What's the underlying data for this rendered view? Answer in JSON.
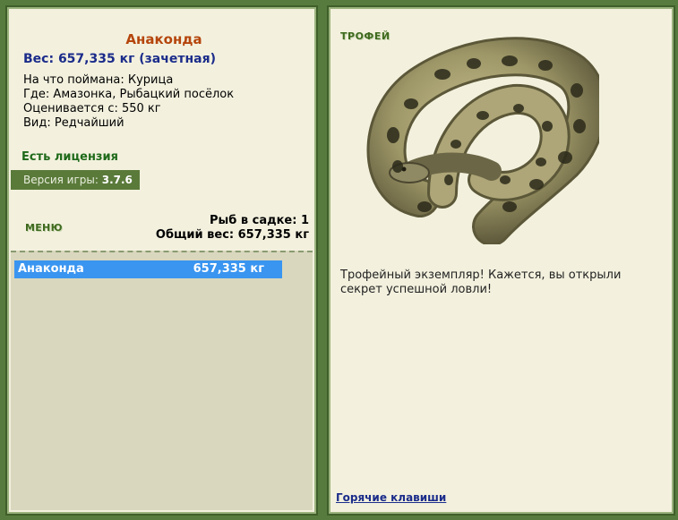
{
  "fish": {
    "name": "Анаконда",
    "weight_line": "Вес: 657,335 кг (зачетная)",
    "bait_line": "На что поймана: Курица",
    "location_line": "Где: Амазонка, Рыбацкий посёлок",
    "value_line": "Оценивается с: 550 кг",
    "kind_line": "Вид: Редчайший"
  },
  "license": "Есть лицензия",
  "version": {
    "label": "Версия игры:",
    "value": "3.7.6"
  },
  "menu_label": "МЕНЮ",
  "keepnet": {
    "count_line": "Рыб в садке: 1",
    "total_line": "Общий вес: 657,335 кг",
    "items": [
      {
        "name": "Анаконда",
        "weight": "657,335 кг",
        "selected": true
      }
    ]
  },
  "trophy": {
    "title": "ТРОФЕЙ",
    "image_icon": "anaconda-image",
    "text": "Трофейный экземпляр! Кажется, вы открыли секрет успешной ловли!"
  },
  "hotkeys_label": "Горячие клавиши",
  "colors": {
    "background": "#577a3e",
    "panel": "#f3f1de",
    "list_background": "#d9d7bd",
    "selection": "#3a95f0",
    "fish_name": "#b5450c",
    "weight": "#1b2c8a",
    "license": "#1f6a1a"
  }
}
